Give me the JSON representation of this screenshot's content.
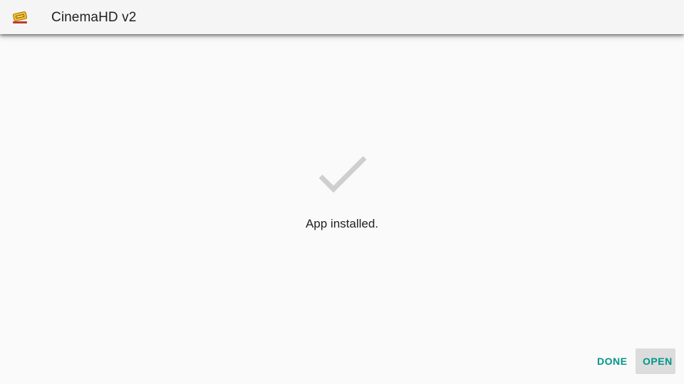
{
  "app_bar": {
    "icon": "cinema-ticket-icon",
    "title": "CinemaHD v2"
  },
  "main": {
    "status_icon": "check-icon",
    "status_text": "App installed."
  },
  "actions": {
    "done_label": "DONE",
    "open_label": "OPEN"
  },
  "colors": {
    "accent": "#009688",
    "check": "#cfcfcf",
    "background": "#fafafa",
    "app_bar": "#f5f5f5",
    "focused_button": "#dcdcdc"
  }
}
